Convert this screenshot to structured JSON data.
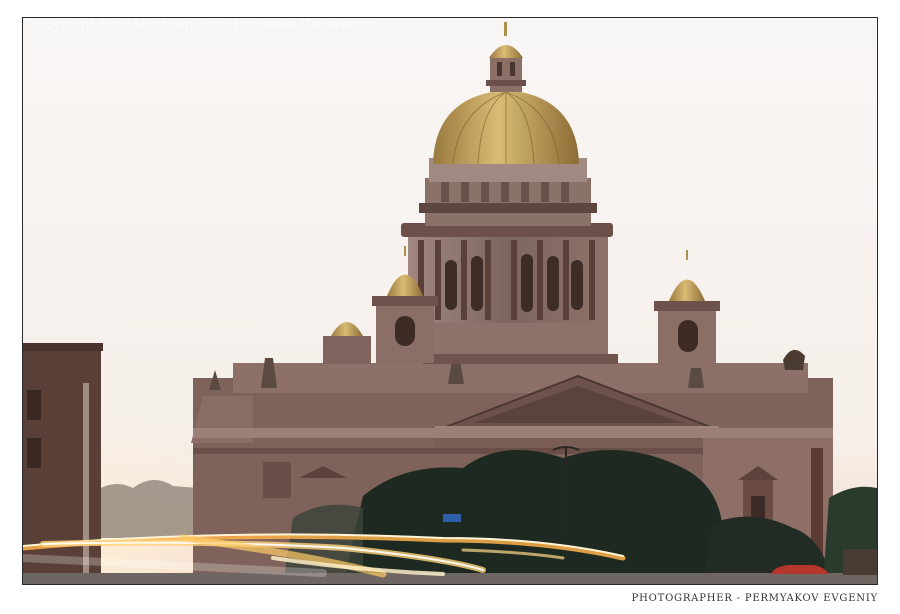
{
  "watermark": {
    "text": "Copyright PhotoPodium.com Евгений Пермяков"
  },
  "credit": {
    "text": "PHOTOGRAPHER - PERMYAKOV EVGENIY"
  },
  "photo": {
    "subject": "cathedral-dome-at-dusk",
    "colors": {
      "sky": "#f7f3f0",
      "dome_gold": "#c8a35a",
      "stone": "#8a7068",
      "shadow": "#4a3a36",
      "trees": "#1f2a22",
      "light_trails": "#ffd27a"
    }
  }
}
